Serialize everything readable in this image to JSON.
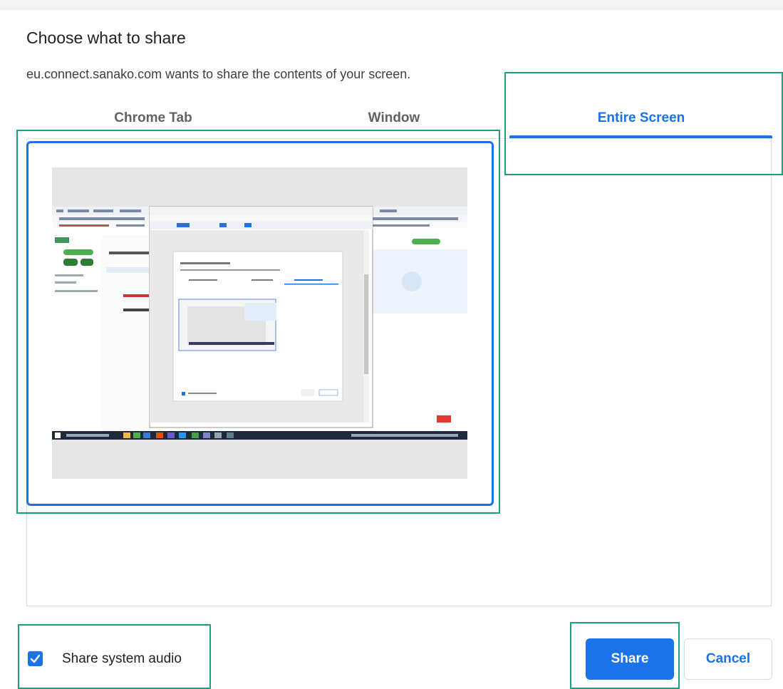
{
  "dialog": {
    "title": "Choose what to share",
    "subtitle": "eu.connect.sanako.com wants to share the contents of your screen."
  },
  "tabs": [
    {
      "label": "Chrome Tab",
      "active": false
    },
    {
      "label": "Window",
      "active": false
    },
    {
      "label": "Entire Screen",
      "active": true
    }
  ],
  "source": {
    "selected": true,
    "preview": "screen-thumbnail"
  },
  "audio": {
    "label": "Share system audio",
    "checked": true
  },
  "buttons": {
    "share_label": "Share",
    "cancel_label": "Cancel"
  },
  "colors": {
    "accent": "#1a73e8",
    "highlight": "#1aa07a",
    "text": "#202124",
    "muted_tab": "#5f6368"
  }
}
